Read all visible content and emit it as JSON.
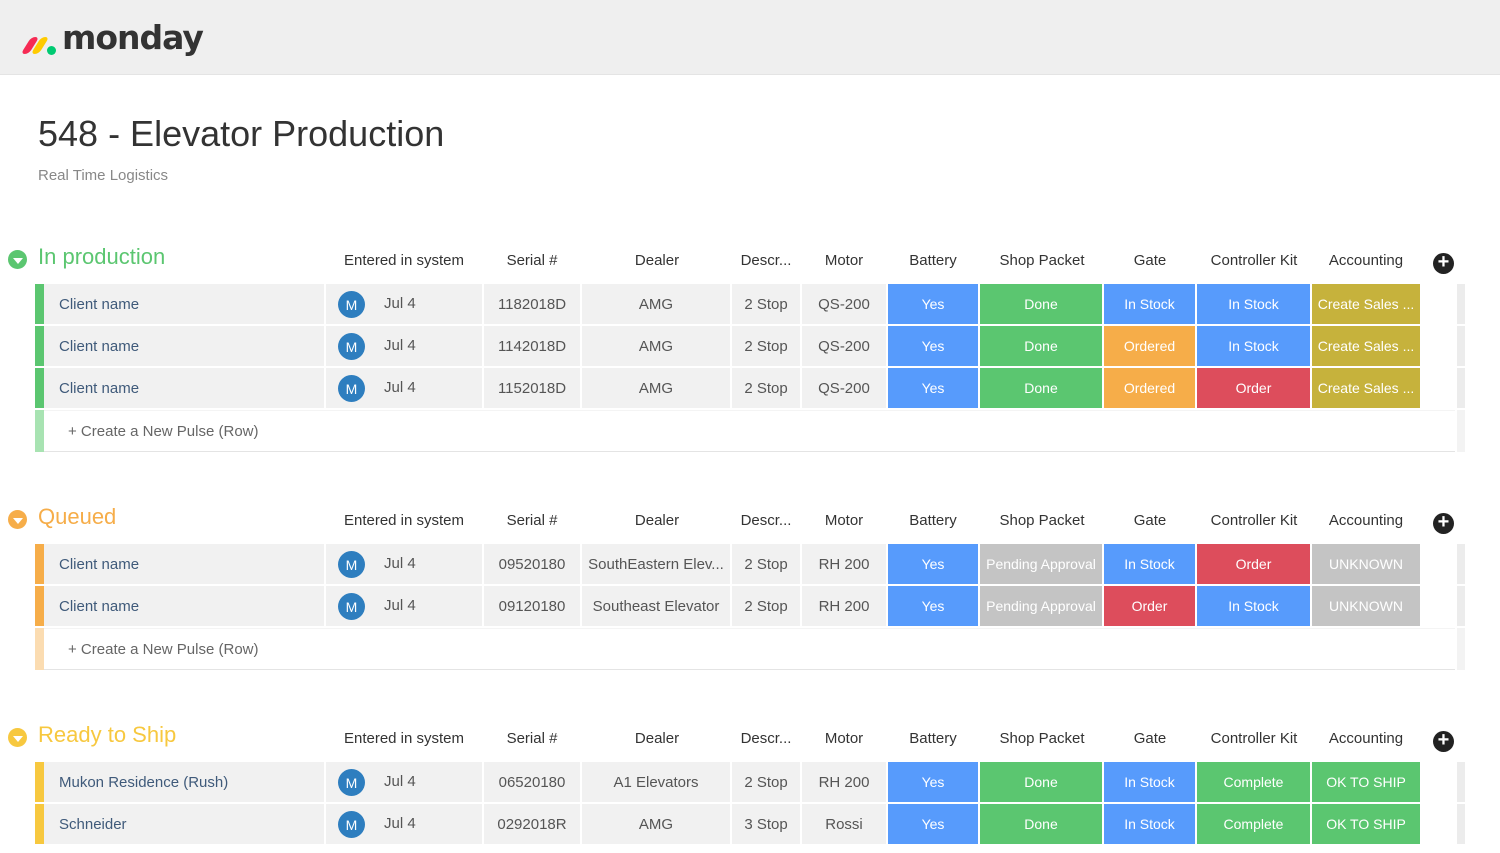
{
  "app": {
    "logo_text": "monday"
  },
  "board": {
    "title": "548 - Elevator Production",
    "subtitle": "Real Time Logistics"
  },
  "columns": [
    "Entered in system",
    "Serial #",
    "Dealer",
    "Descr...",
    "Motor",
    "Battery",
    "Shop Packet",
    "Gate",
    "Controller Kit",
    "Accounting"
  ],
  "create_label": "+ Create a New Pulse (Row)",
  "colors": {
    "blue": "#579bfc",
    "green": "#5bc670",
    "orange": "#f6ad49",
    "red": "#dd4d5c",
    "mustard": "#c6b23c",
    "grey": "#c4c4c4",
    "group_green": "#5bc670",
    "group_orange": "#f6ad49",
    "group_yellow": "#f7c83f"
  },
  "groups": [
    {
      "name": "In production",
      "color": "#5bc670",
      "bar_color": "#5bc670",
      "create_bar": "#a8e3b2",
      "rows": [
        {
          "name": "Client name",
          "avatar": "M",
          "date": "Jul 4",
          "serial": "1182018D",
          "dealer": "AMG",
          "descr": "2 Stop",
          "motor": "QS-200",
          "battery": {
            "text": "Yes",
            "color": "#579bfc"
          },
          "shop": {
            "text": "Done",
            "color": "#5bc670"
          },
          "gate": {
            "text": "In Stock",
            "color": "#579bfc"
          },
          "kit": {
            "text": "In Stock",
            "color": "#579bfc"
          },
          "acct": {
            "text": "Create Sales ...",
            "color": "#c6b23c"
          }
        },
        {
          "name": "Client name",
          "avatar": "M",
          "date": "Jul 4",
          "serial": "1142018D",
          "dealer": "AMG",
          "descr": "2 Stop",
          "motor": "QS-200",
          "battery": {
            "text": "Yes",
            "color": "#579bfc"
          },
          "shop": {
            "text": "Done",
            "color": "#5bc670"
          },
          "gate": {
            "text": "Ordered",
            "color": "#f6ad49"
          },
          "kit": {
            "text": "In Stock",
            "color": "#579bfc"
          },
          "acct": {
            "text": "Create Sales ...",
            "color": "#c6b23c"
          }
        },
        {
          "name": "Client name",
          "avatar": "M",
          "date": "Jul 4",
          "serial": "1152018D",
          "dealer": "AMG",
          "descr": "2 Stop",
          "motor": "QS-200",
          "battery": {
            "text": "Yes",
            "color": "#579bfc"
          },
          "shop": {
            "text": "Done",
            "color": "#5bc670"
          },
          "gate": {
            "text": "Ordered",
            "color": "#f6ad49"
          },
          "kit": {
            "text": "Order",
            "color": "#dd4d5c"
          },
          "acct": {
            "text": "Create Sales ...",
            "color": "#c6b23c"
          }
        }
      ]
    },
    {
      "name": "Queued",
      "color": "#f6ad49",
      "bar_color": "#f6ad49",
      "create_bar": "#fbdcb1",
      "rows": [
        {
          "name": "Client name",
          "avatar": "M",
          "date": "Jul 4",
          "serial": "09520180",
          "dealer": "SouthEastern Elev...",
          "descr": "2 Stop",
          "motor": "RH 200",
          "battery": {
            "text": "Yes",
            "color": "#579bfc"
          },
          "shop": {
            "text": "Pending Approval",
            "color": "#c4c4c4"
          },
          "gate": {
            "text": "In Stock",
            "color": "#579bfc"
          },
          "kit": {
            "text": "Order",
            "color": "#dd4d5c"
          },
          "acct": {
            "text": "UNKNOWN",
            "color": "#c4c4c4"
          }
        },
        {
          "name": "Client name",
          "avatar": "M",
          "date": "Jul 4",
          "serial": "09120180",
          "dealer": "Southeast Elevator",
          "descr": "2 Stop",
          "motor": "RH 200",
          "battery": {
            "text": "Yes",
            "color": "#579bfc"
          },
          "shop": {
            "text": "Pending Approval",
            "color": "#c4c4c4"
          },
          "gate": {
            "text": "Order",
            "color": "#dd4d5c"
          },
          "kit": {
            "text": "In Stock",
            "color": "#579bfc"
          },
          "acct": {
            "text": "UNKNOWN",
            "color": "#c4c4c4"
          }
        }
      ]
    },
    {
      "name": "Ready to Ship",
      "color": "#f7c83f",
      "bar_color": "#f7c83f",
      "create_bar": "#fbe7a8",
      "rows": [
        {
          "name": "Mukon Residence (Rush)",
          "avatar": "M",
          "date": "Jul 4",
          "serial": "06520180",
          "dealer": "A1 Elevators",
          "descr": "2 Stop",
          "motor": "RH 200",
          "battery": {
            "text": "Yes",
            "color": "#579bfc"
          },
          "shop": {
            "text": "Done",
            "color": "#5bc670"
          },
          "gate": {
            "text": "In Stock",
            "color": "#579bfc"
          },
          "kit": {
            "text": "Complete",
            "color": "#5bc670"
          },
          "acct": {
            "text": "OK TO SHIP",
            "color": "#5bc670"
          }
        },
        {
          "name": "Schneider",
          "avatar": "M",
          "date": "Jul 4",
          "serial": "0292018R",
          "dealer": "AMG",
          "descr": "3 Stop",
          "motor": "Rossi",
          "battery": {
            "text": "Yes",
            "color": "#579bfc"
          },
          "shop": {
            "text": "Done",
            "color": "#5bc670"
          },
          "gate": {
            "text": "In Stock",
            "color": "#579bfc"
          },
          "kit": {
            "text": "Complete",
            "color": "#5bc670"
          },
          "acct": {
            "text": "OK TO SHIP",
            "color": "#5bc670"
          }
        }
      ]
    }
  ]
}
